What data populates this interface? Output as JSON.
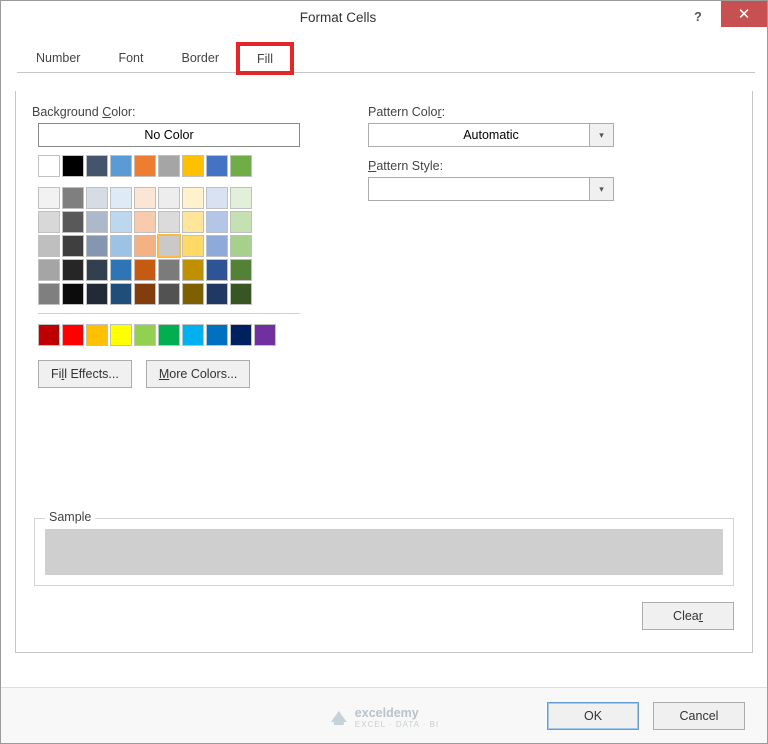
{
  "title": "Format Cells",
  "tabs": {
    "number": "Number",
    "font": "Font",
    "border": "Border",
    "fill": "Fill"
  },
  "fill": {
    "bg_label_pre": "Background ",
    "bg_label_u": "C",
    "bg_label_post": "olor:",
    "no_color": "No Color",
    "pattern_color_label_pre": "Pattern Colo",
    "pattern_color_label_u": "r",
    "pattern_color_label_post": ":",
    "pattern_color_value": "Automatic",
    "pattern_style_label_pre": "",
    "pattern_style_label_u": "P",
    "pattern_style_label_post": "attern Style:",
    "fill_effects_pre": "Fi",
    "fill_effects_u": "l",
    "fill_effects_post": "l Effects...",
    "more_colors_pre": "",
    "more_colors_u": "M",
    "more_colors_post": "ore Colors..."
  },
  "palette": {
    "row1": [
      "#ffffff",
      "#000000",
      "#44546a",
      "#5b9bd5",
      "#ed7d31",
      "#a5a5a5",
      "#ffc000",
      "#4472c4",
      "#70ad47"
    ],
    "themeRows": [
      [
        "#f2f2f2",
        "#7f7f7f",
        "#d6dce4",
        "#deebf6",
        "#fbe5d5",
        "#ededed",
        "#fff2cc",
        "#d9e2f3",
        "#e2efd9"
      ],
      [
        "#d8d8d8",
        "#595959",
        "#adb9ca",
        "#bdd7ee",
        "#f7cbac",
        "#dbdbdb",
        "#fee599",
        "#b4c6e7",
        "#c5e0b3"
      ],
      [
        "#bfbfbf",
        "#3f3f3f",
        "#8496b0",
        "#9cc3e5",
        "#f4b183",
        "#c9c9c9",
        "#ffd965",
        "#8eaadb",
        "#a8d08d"
      ],
      [
        "#a5a5a5",
        "#262626",
        "#323f4f",
        "#2e75b5",
        "#c55a11",
        "#7b7b7b",
        "#bf9000",
        "#2f5496",
        "#538135"
      ],
      [
        "#7f7f7f",
        "#0c0c0c",
        "#222a35",
        "#1e4e79",
        "#833c0b",
        "#525252",
        "#7f6000",
        "#1f3864",
        "#375623"
      ]
    ],
    "standard": [
      "#c00000",
      "#ff0000",
      "#ffc000",
      "#ffff00",
      "#92d050",
      "#00b050",
      "#00b0f0",
      "#0070c0",
      "#002060",
      "#7030a0"
    ]
  },
  "sample_label": "Sample",
  "clear_pre": "Clea",
  "clear_u": "r",
  "ok": "OK",
  "cancel": "Cancel",
  "watermark": {
    "name": "exceldemy",
    "tag": "EXCEL · DATA · BI"
  }
}
